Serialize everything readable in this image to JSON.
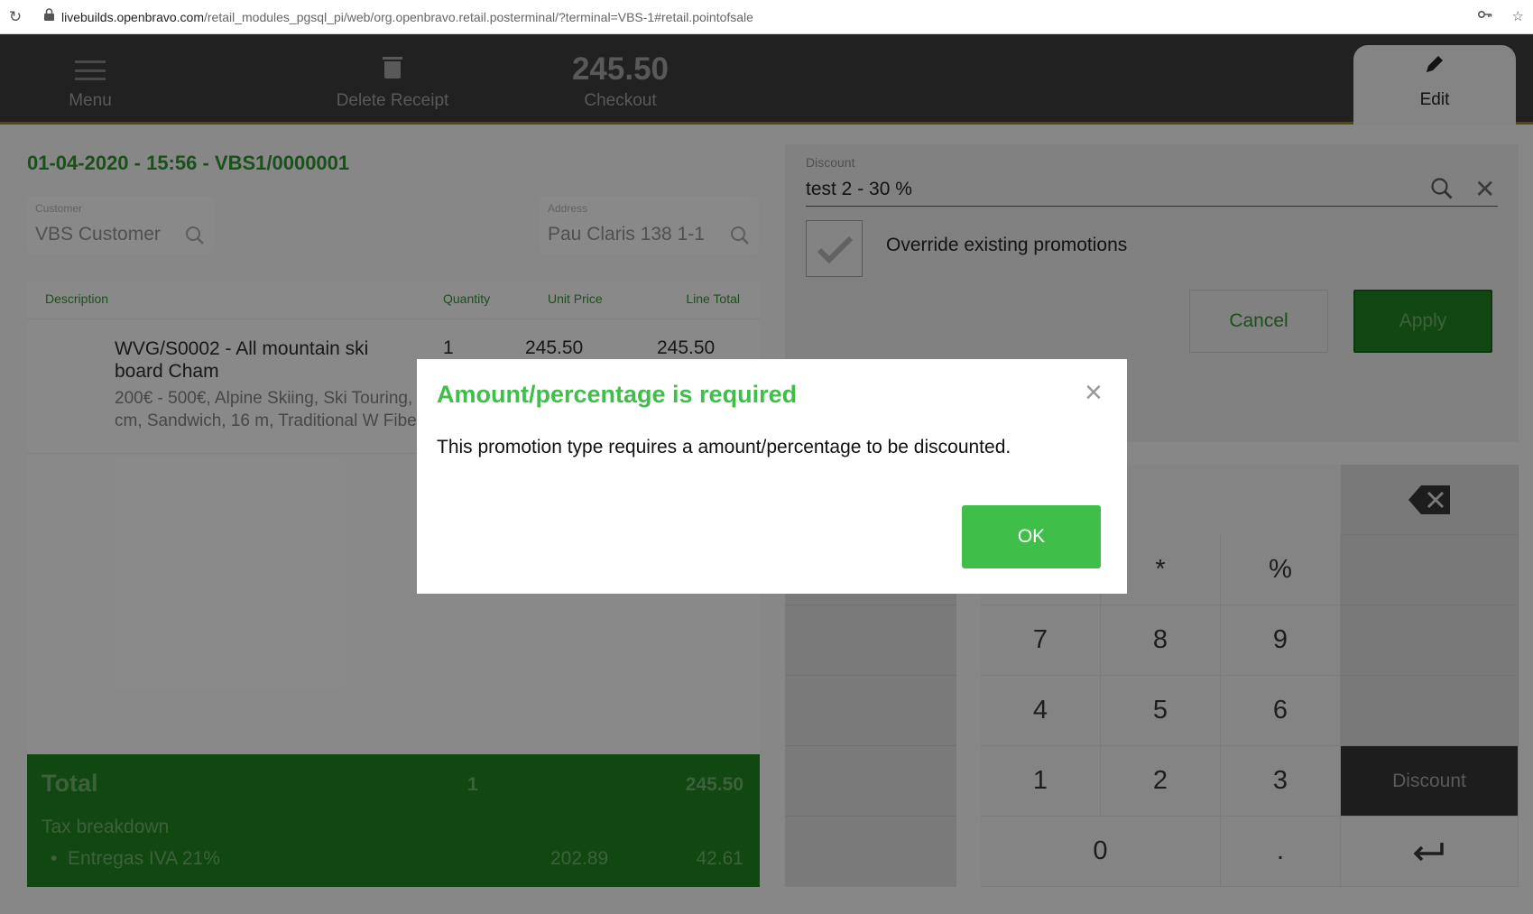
{
  "browser": {
    "url_host": "livebuilds.openbravo.com",
    "url_path": "/retail_modules_pgsql_pi/web/org.openbravo.retail.posterminal/?terminal=VBS-1#retail.pointofsale",
    "reload_icon": "reload-icon",
    "lock_icon": "lock-icon",
    "key_icon": "key-icon",
    "star_icon": "star-icon"
  },
  "toolbar": {
    "menu_label": "Menu",
    "delete_label": "Delete Receipt",
    "checkout_amount": "245.50",
    "checkout_label": "Checkout",
    "edit_label": "Edit"
  },
  "receipt": {
    "title": "01-04-2020 - 15:56 - VBS1/0000001",
    "customer_label": "Customer",
    "customer_value": "VBS Customer",
    "address_label": "Address",
    "address_value": "Pau Claris 138 1-1"
  },
  "lines_table": {
    "headers": {
      "description": "Description",
      "quantity": "Quantity",
      "unit_price": "Unit Price",
      "line_total": "Line Total"
    },
    "rows": [
      {
        "name": "WVG/S0002 - All mountain ski board Cham",
        "attributes": "200€ - 500€, Alpine Skiing, Ski Touring, 172 cm, Sandwich, 16 m, Traditional W Fiber",
        "quantity": "1",
        "unit_price": "245.50",
        "line_total": "245.50"
      }
    ]
  },
  "totals": {
    "label": "Total",
    "quantity": "1",
    "amount": "245.50",
    "tax_label": "Tax breakdown",
    "tax_name": "Entregas IVA 21%",
    "tax_base": "202.89",
    "tax_amount": "42.61"
  },
  "discount_form": {
    "field_label": "Discount",
    "field_value": "test 2 - 30 %",
    "override_label": "Override existing promotions",
    "override_checked": true,
    "cancel_label": "Cancel",
    "apply_label": "Apply"
  },
  "keypad": {
    "row0": [
      "",
      "*",
      "%"
    ],
    "row1": [
      "7",
      "8",
      "9"
    ],
    "row2": [
      "4",
      "5",
      "6"
    ],
    "row3": [
      "1",
      "2",
      "3"
    ],
    "row4": [
      "0",
      "."
    ],
    "discount_label": "Discount",
    "backspace_icon": "backspace-icon",
    "enter_icon": "enter-icon"
  },
  "modal": {
    "title": "Amount/percentage is required",
    "message": "This promotion type requires a amount/percentage to be discounted.",
    "ok_label": "OK",
    "close_glyph": "×"
  },
  "colors": {
    "accent_green": "#3fbf4a",
    "dark_green": "#1e7a1e",
    "toolbar": "#3a3a3a"
  }
}
